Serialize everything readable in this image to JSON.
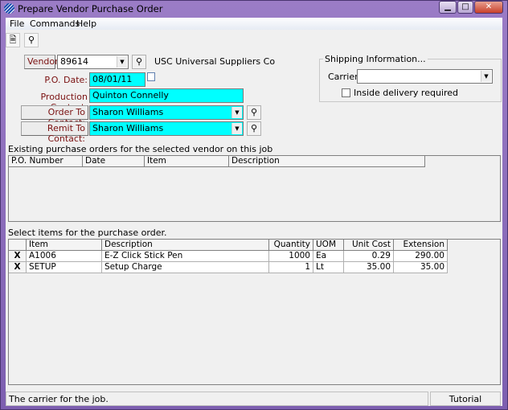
{
  "window": {
    "title": "Prepare Vendor Purchase Order",
    "minimize": "▁",
    "maximize": "□",
    "close": "✕"
  },
  "menu": [
    "File",
    "Commands",
    "Help"
  ],
  "toolbar": [
    {
      "icon": "new-document-icon"
    },
    {
      "icon": "find-binoculars-icon"
    }
  ],
  "form": {
    "vendor_label": "Vendor:",
    "vendor_value": "89614",
    "vendor_name": "USC Universal Suppliers Co",
    "po_date_label": "P.O. Date:",
    "po_date_value": "08/01/11",
    "production_contact_label": "Production Contact:",
    "production_contact_value": "Quinton Connelly",
    "order_to_label": "Order To Contact:",
    "order_to_value": "Sharon Williams",
    "remit_to_label": "Remit To Contact:",
    "remit_to_value": "Sharon Williams"
  },
  "shipping": {
    "title": "Shipping Information...",
    "carrier_label": "Carrier:",
    "carrier_value": "",
    "inside_delivery_label": "Inside delivery required",
    "inside_delivery_checked": false
  },
  "existing": {
    "caption": "Existing purchase orders for the selected vendor on this job",
    "columns": [
      "P.O. Number",
      "Date",
      "Item",
      "Description"
    ],
    "rows": []
  },
  "items": {
    "caption": "Select items for the purchase order.",
    "columns": [
      "",
      "Item",
      "Description",
      "Quantity",
      "UOM",
      "Unit Cost",
      "Extension"
    ],
    "rows": [
      [
        "X",
        "A1006",
        "E-Z Click Stick Pen",
        "1000",
        "Ea",
        "0.29",
        "290.00"
      ],
      [
        "X",
        "SETUP",
        "Setup Charge",
        "1",
        "Lt",
        "35.00",
        "35.00"
      ]
    ]
  },
  "status": {
    "message": "The carrier for the job.",
    "mode": "Tutorial"
  }
}
